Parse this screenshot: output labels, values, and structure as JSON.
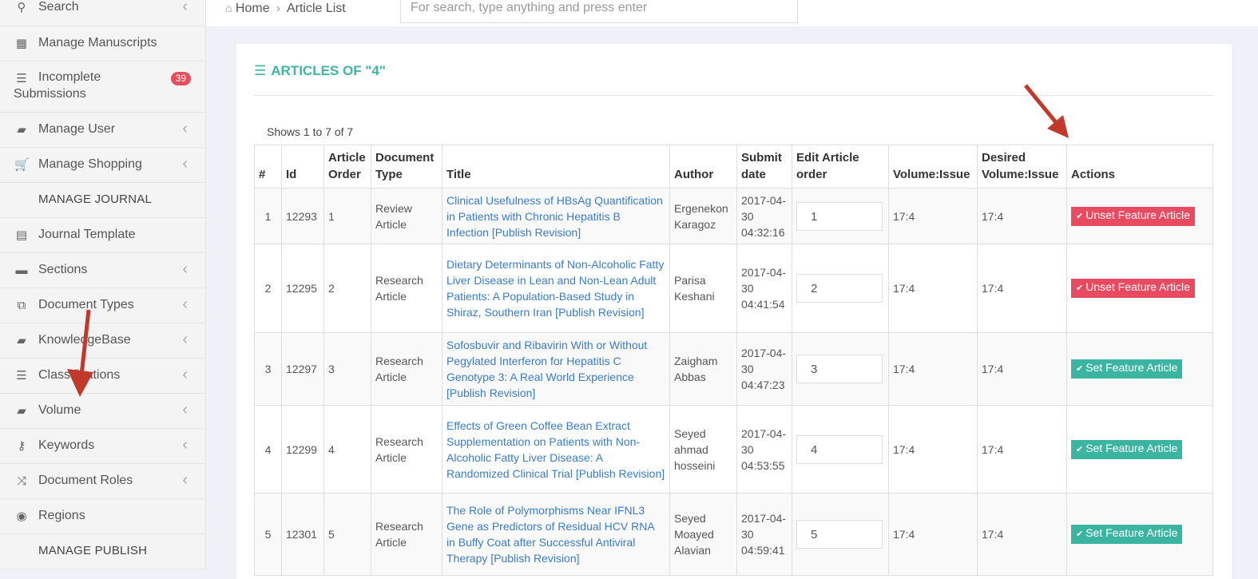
{
  "sidebar": {
    "items": [
      {
        "label": "Search",
        "icon": "search-icon",
        "glyph": "⚲",
        "chevron": true
      },
      {
        "label": "Manage Manuscripts",
        "icon": "dashboard-icon",
        "glyph": "▦",
        "chevron": false
      },
      {
        "label": "Incomplete",
        "label2": "Submissions",
        "icon": "list-icon",
        "glyph": "☰",
        "badge": "39"
      },
      {
        "label": "Manage User",
        "icon": "book-icon",
        "glyph": "▰",
        "chevron": true
      },
      {
        "label": "Manage Shopping",
        "icon": "cart-icon",
        "glyph": "🛒",
        "chevron": true
      },
      {
        "label": "MANAGE JOURNAL",
        "header": true
      },
      {
        "label": "Journal Template",
        "icon": "template-icon",
        "glyph": "▤",
        "chevron": false
      },
      {
        "label": "Sections",
        "icon": "folder-icon",
        "glyph": "▬",
        "chevron": true
      },
      {
        "label": "Document Types",
        "icon": "copy-icon",
        "glyph": "⧉",
        "chevron": true
      },
      {
        "label": "KnowledgeBase",
        "icon": "book-icon",
        "glyph": "▰",
        "chevron": true
      },
      {
        "label": "Classifications",
        "icon": "tasks-icon",
        "glyph": "☰",
        "chevron": true
      },
      {
        "label": "Volume",
        "icon": "book-icon",
        "glyph": "▰",
        "chevron": true
      },
      {
        "label": "Keywords",
        "icon": "key-icon",
        "glyph": "⚷",
        "chevron": true
      },
      {
        "label": "Document Roles",
        "icon": "random-icon",
        "glyph": "⤨",
        "chevron": true
      },
      {
        "label": "Regions",
        "icon": "globe-icon",
        "glyph": "◉",
        "chevron": false
      },
      {
        "label": "MANAGE PUBLISH",
        "header": true
      }
    ]
  },
  "breadcrumb": {
    "home": "Home",
    "current": "Article List"
  },
  "search": {
    "placeholder": "For search, type anything and press enter"
  },
  "panel": {
    "title": "ARTICLES OF \"4\"",
    "shows": "Shows 1 to 7 of 7"
  },
  "table": {
    "headers": [
      "#",
      "Id",
      "Article Order",
      "Document Type",
      "Title",
      "Author",
      "Submit date",
      "Edit Article order",
      "Volume:Issue",
      "Desired Volume:Issue",
      "Actions"
    ],
    "rows": [
      {
        "num": "1",
        "id": "12293",
        "order": "1",
        "doctype": "Review Article",
        "title": "Clinical Usefulness of HBsAg Quantification in Patients with Chronic Hepatitis B Infection [Publish Revision]",
        "author": "Ergenekon Karagoz",
        "date": "2017-04-30 04:32:16",
        "edit_order": "1",
        "vol": "17:4",
        "desired": "17:4",
        "action": "Unset Feature Article",
        "featured": true
      },
      {
        "num": "2",
        "id": "12295",
        "order": "2",
        "doctype": "Research Article",
        "title": "Dietary Determinants of Non-Alcoholic Fatty Liver Disease in Lean and Non-Lean Adult Patients: A Population-Based Study in Shiraz, Southern Iran [Publish Revision]",
        "author": "Parisa Keshani",
        "date": "2017-04-30 04:41:54",
        "edit_order": "2",
        "vol": "17:4",
        "desired": "17:4",
        "action": "Unset Feature Article",
        "featured": true
      },
      {
        "num": "3",
        "id": "12297",
        "order": "3",
        "doctype": "Research Article",
        "title": "Sofosbuvir and Ribavirin With or Without Pegylated Interferon for Hepatitis C Genotype 3: A Real World Experience [Publish Revision]",
        "author": "Zaigham Abbas",
        "date": "2017-04-30 04:47:23",
        "edit_order": "3",
        "vol": "17:4",
        "desired": "17:4",
        "action": "Set Feature Article",
        "featured": false
      },
      {
        "num": "4",
        "id": "12299",
        "order": "4",
        "doctype": "Research Article",
        "title": "Effects of Green Coffee Bean Extract Supplementation on Patients with Non-Alcoholic Fatty Liver Disease: A Randomized Clinical Trial [Publish Revision]",
        "author": "Seyed ahmad hosseini",
        "date": "2017-04-30 04:53:55",
        "edit_order": "4",
        "vol": "17:4",
        "desired": "17:4",
        "action": "Set Feature Article",
        "featured": false
      },
      {
        "num": "5",
        "id": "12301",
        "order": "5",
        "doctype": "Research Article",
        "title": "The Role of Polymorphisms Near IFNL3 Gene as Predictors of Residual HCV RNA in Buffy Coat after Successful Antiviral Therapy [Publish Revision]",
        "author": "Seyed Moayed Alavian",
        "date": "2017-04-30 04:59:41",
        "edit_order": "5",
        "vol": "17:4",
        "desired": "17:4",
        "action": "Set Feature Article",
        "featured": false
      }
    ]
  },
  "colors": {
    "accent": "#3fb5a5",
    "unset": "#e84a5f",
    "set": "#3cb4a2",
    "link": "#3a7cc4",
    "badge": "#e84d5b",
    "arrow": "#c0392b"
  }
}
